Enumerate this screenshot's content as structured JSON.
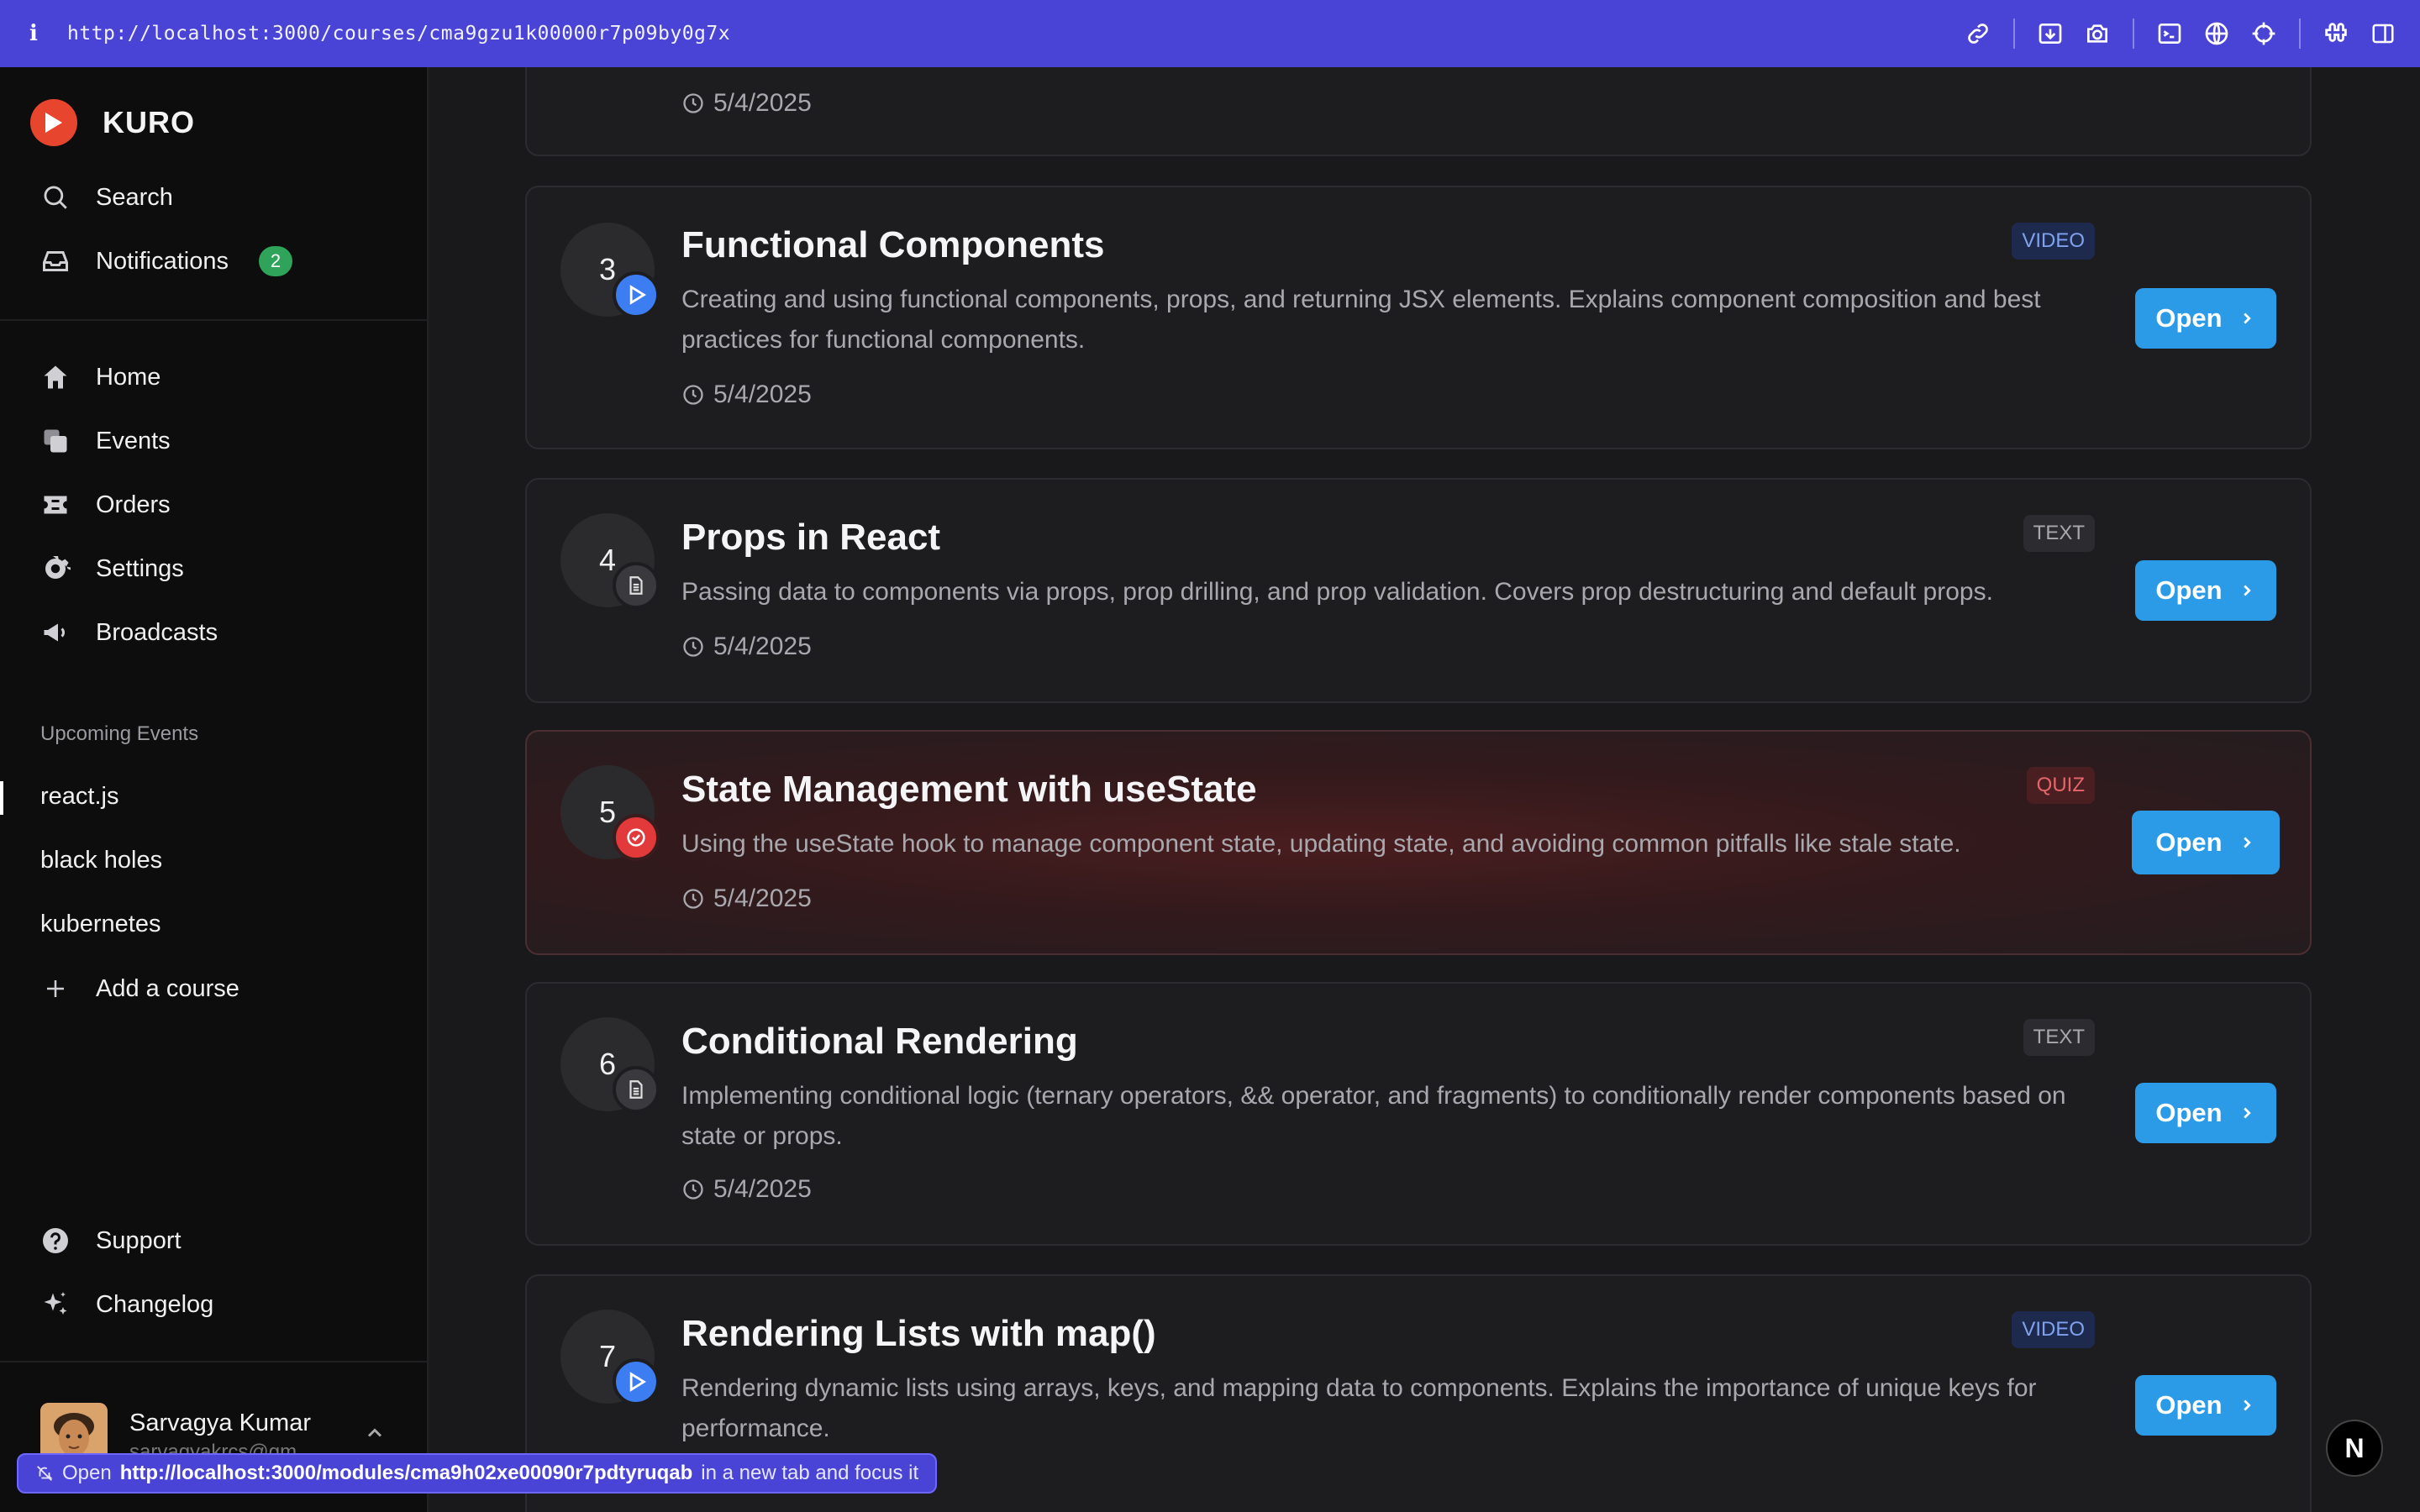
{
  "browser": {
    "url": "http://localhost:3000/courses/cma9gzu1k00000r7p09by0g7x",
    "info_glyph": "i"
  },
  "sidebar": {
    "brand": "KURO",
    "search": "Search",
    "notifications": "Notifications",
    "notifications_count": "2",
    "nav": [
      {
        "label": "Home",
        "icon": "home-icon"
      },
      {
        "label": "Events",
        "icon": "events-icon"
      },
      {
        "label": "Orders",
        "icon": "ticket-icon"
      },
      {
        "label": "Settings",
        "icon": "gear-icon"
      },
      {
        "label": "Broadcasts",
        "icon": "megaphone-icon"
      }
    ],
    "section_label": "Upcoming Events",
    "courses": [
      "react.js",
      "black holes",
      "kubernetes"
    ],
    "add_course": "Add a course",
    "support": "Support",
    "changelog": "Changelog",
    "user": {
      "name": "Sarvagya Kumar",
      "email": "sarvagyakrcs@gm"
    }
  },
  "lessons": [
    {
      "number": "",
      "title": "",
      "desc": "",
      "date": "5/4/2025",
      "type": "",
      "open": ""
    },
    {
      "number": "3",
      "title": "Functional Components",
      "desc": "Creating and using functional components, props, and returning JSX elements. Explains component composition and best practices for functional components.",
      "date": "5/4/2025",
      "type": "VIDEO",
      "open": "Open"
    },
    {
      "number": "4",
      "title": "Props in React",
      "desc": "Passing data to components via props, prop drilling, and prop validation. Covers prop destructuring and default props.",
      "date": "5/4/2025",
      "type": "TEXT",
      "open": "Open"
    },
    {
      "number": "5",
      "title": "State Management with useState",
      "desc": "Using the useState hook to manage component state, updating state, and avoiding common pitfalls like stale state.",
      "date": "5/4/2025",
      "type": "QUIZ",
      "open": "Open"
    },
    {
      "number": "6",
      "title": "Conditional Rendering",
      "desc": "Implementing conditional logic (ternary operators, && operator, and fragments) to conditionally render components based on state or props.",
      "date": "5/4/2025",
      "type": "TEXT",
      "open": "Open"
    },
    {
      "number": "7",
      "title": "Rendering Lists with map()",
      "desc": "Rendering dynamic lists using arrays, keys, and mapping data to components. Explains the importance of unique keys for performance.",
      "date": "",
      "type": "VIDEO",
      "open": "Open"
    }
  ],
  "status_tip": {
    "prefix": "Open",
    "url": "http://localhost:3000/modules/cma9h02xe00090r7pdtyruqab",
    "suffix": "in a new tab and focus it"
  },
  "next_badge": "N",
  "colors": {
    "accent": "#2b9be8",
    "chrome": "#4a44d6",
    "brand": "#e8452f",
    "quiz": "#e23a3a",
    "video": "#3d7df2"
  }
}
